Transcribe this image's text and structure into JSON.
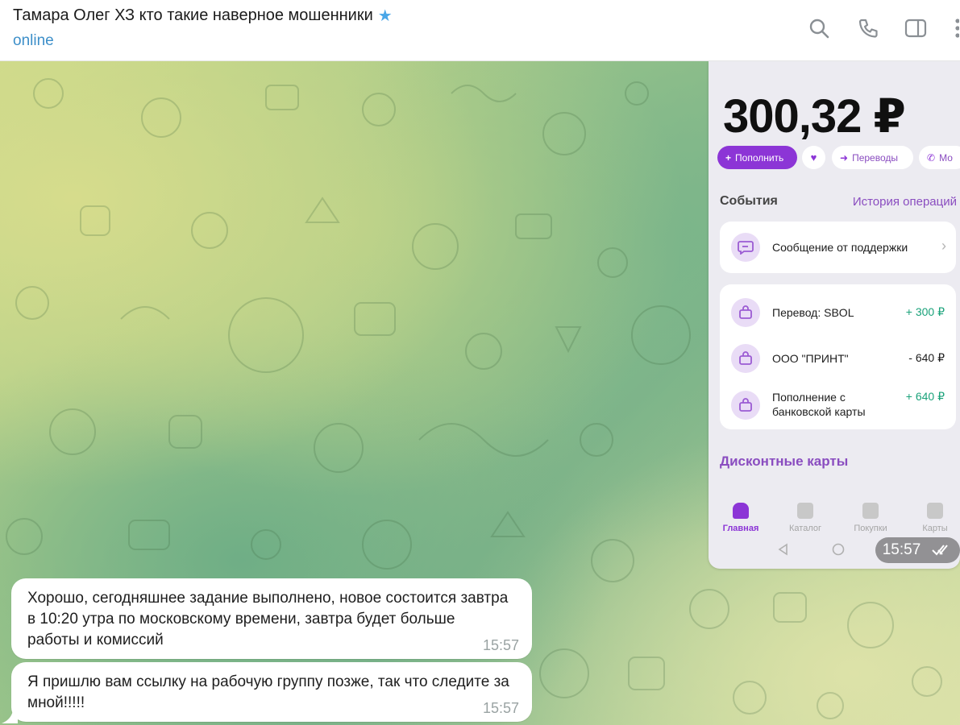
{
  "header": {
    "title": "Тамара Олег ХЗ кто такие наверное мошенники",
    "status": "online",
    "icons": [
      "star-icon",
      "search-icon",
      "phone-icon",
      "sidebar-toggle-icon",
      "more-icon"
    ]
  },
  "bank_app": {
    "balance": "300,32 ₽",
    "actions": [
      {
        "label": "Пополнить",
        "icon": "plus-icon"
      },
      {
        "label": "",
        "icon": "heart-icon"
      },
      {
        "label": "Переводы",
        "icon": "arrow-right-icon"
      },
      {
        "label": "Мо",
        "icon": "phone-icon"
      }
    ],
    "events_title": "События",
    "history_link": "История операций",
    "support_message": "Сообщение от поддержки",
    "transactions": [
      {
        "label": "Перевод: SBOL",
        "amount": "+ 300 ₽"
      },
      {
        "label": "ООО \"ПРИНТ\"",
        "amount": "- 640 ₽"
      },
      {
        "label": "Пополнение с банковской карты",
        "amount": "+ 640 ₽"
      }
    ],
    "discount_cards": "Дисконтные карты",
    "tabs": [
      "Главная",
      "Каталог",
      "Покупки",
      "Карты"
    ],
    "screenshot_time": "15:57",
    "colors": {
      "accent": "#8c35d6",
      "positive": "#1aa27a"
    }
  },
  "messages": [
    {
      "text": "Хорошо, сегодняшнее задание выполнено, новое состоится завтра в 10:20 утра по московскому времени, завтра будет больше работы и комиссий",
      "time": "15:57"
    },
    {
      "text": "Я пришлю вам ссылку на рабочую группу позже, так что следите за мной!!!!!",
      "time": "15:57"
    }
  ]
}
